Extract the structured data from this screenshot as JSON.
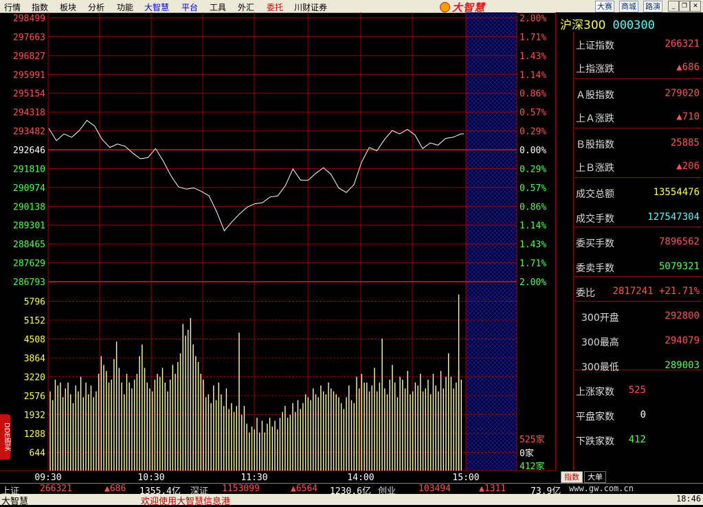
{
  "menu": {
    "items": [
      {
        "label": "行情",
        "color": "#000000"
      },
      {
        "label": "指数",
        "color": "#000000"
      },
      {
        "label": "板块",
        "color": "#000000"
      },
      {
        "label": "分析",
        "color": "#000000"
      },
      {
        "label": "功能",
        "color": "#000000"
      },
      {
        "label": "大智慧",
        "color": "#0000c8"
      },
      {
        "label": "平台",
        "color": "#0000c8"
      },
      {
        "label": "工具",
        "color": "#000000"
      },
      {
        "label": "外汇",
        "color": "#000000"
      },
      {
        "label": "委托",
        "color": "#c80000"
      },
      {
        "label": "川财证券",
        "color": "#000000"
      }
    ],
    "brand": "大智慧",
    "right_buttons": [
      "大赛",
      "商城",
      "路演"
    ]
  },
  "colors": {
    "up": "#ff5454",
    "down": "#54ff54",
    "grid": "#a00000",
    "line": "#ffffff",
    "volume": "#ffffb0",
    "yellow": "#ffff54",
    "cyan": "#54ffff"
  },
  "chart_data": {
    "type": "line",
    "price_axis_left": [
      "298499",
      "297663",
      "296827",
      "295991",
      "295154",
      "294318",
      "293482",
      "292646",
      "291810",
      "290974",
      "290138",
      "289301",
      "288465",
      "287629",
      "286793"
    ],
    "pct_axis_right": [
      "2.00%",
      "1.71%",
      "1.43%",
      "1.14%",
      "0.86%",
      "0.57%",
      "0.29%",
      "0.00%",
      "0.29%",
      "0.57%",
      "0.86%",
      "1.14%",
      "1.43%",
      "1.71%",
      "2.00%"
    ],
    "base_price": "292646",
    "ylim": [
      286793,
      298499
    ],
    "x_ticks": [
      "09:30",
      "10:30",
      "11:30",
      "14:00",
      "15:00"
    ],
    "price_series": [
      {
        "t": 0,
        "v": 293600
      },
      {
        "t": 5,
        "v": 293050
      },
      {
        "t": 10,
        "v": 293350
      },
      {
        "t": 15,
        "v": 293200
      },
      {
        "t": 20,
        "v": 293500
      },
      {
        "t": 25,
        "v": 293950
      },
      {
        "t": 30,
        "v": 293700
      },
      {
        "t": 35,
        "v": 293100
      },
      {
        "t": 40,
        "v": 292750
      },
      {
        "t": 45,
        "v": 292900
      },
      {
        "t": 50,
        "v": 292800
      },
      {
        "t": 55,
        "v": 292500
      },
      {
        "t": 60,
        "v": 292250
      },
      {
        "t": 65,
        "v": 292300
      },
      {
        "t": 70,
        "v": 292700
      },
      {
        "t": 75,
        "v": 292150
      },
      {
        "t": 80,
        "v": 291500
      },
      {
        "t": 85,
        "v": 291000
      },
      {
        "t": 90,
        "v": 290900
      },
      {
        "t": 95,
        "v": 290950
      },
      {
        "t": 100,
        "v": 290800
      },
      {
        "t": 105,
        "v": 290600
      },
      {
        "t": 110,
        "v": 289900
      },
      {
        "t": 115,
        "v": 289050
      },
      {
        "t": 120,
        "v": 289450
      },
      {
        "t": 125,
        "v": 289800
      },
      {
        "t": 130,
        "v": 290100
      },
      {
        "t": 135,
        "v": 290250
      },
      {
        "t": 140,
        "v": 290300
      },
      {
        "t": 145,
        "v": 290550
      },
      {
        "t": 150,
        "v": 290600
      },
      {
        "t": 155,
        "v": 291050
      },
      {
        "t": 160,
        "v": 291800
      },
      {
        "t": 165,
        "v": 291300
      },
      {
        "t": 170,
        "v": 291300
      },
      {
        "t": 175,
        "v": 291600
      },
      {
        "t": 180,
        "v": 291850
      },
      {
        "t": 185,
        "v": 291550
      },
      {
        "t": 190,
        "v": 290950
      },
      {
        "t": 195,
        "v": 290750
      },
      {
        "t": 200,
        "v": 291100
      },
      {
        "t": 205,
        "v": 292100
      },
      {
        "t": 210,
        "v": 292750
      },
      {
        "t": 215,
        "v": 292600
      },
      {
        "t": 220,
        "v": 293100
      },
      {
        "t": 225,
        "v": 293500
      },
      {
        "t": 230,
        "v": 293350
      },
      {
        "t": 235,
        "v": 293550
      },
      {
        "t": 240,
        "v": 293300
      },
      {
        "t": 245,
        "v": 292700
      },
      {
        "t": 250,
        "v": 292950
      },
      {
        "t": 255,
        "v": 292850
      },
      {
        "t": 260,
        "v": 293150
      },
      {
        "t": 265,
        "v": 293200
      },
      {
        "t": 270,
        "v": 293350
      },
      {
        "t": 272,
        "v": 293350
      }
    ],
    "volume_axis_left": [
      "5796",
      "5152",
      "4508",
      "3864",
      "3220",
      "2576",
      "1932",
      "1288",
      "644"
    ],
    "volume_ylim": [
      0,
      6440
    ],
    "volume_series": [
      2700,
      2400,
      3100,
      2900,
      3000,
      2500,
      2800,
      3000,
      2600,
      2300,
      2900,
      2700,
      3200,
      2500,
      3000,
      2600,
      2900,
      2500,
      2700,
      3300,
      3900,
      3600,
      3400,
      3000,
      3100,
      3800,
      4400,
      3500,
      3000,
      2600,
      3300,
      3000,
      2800,
      3100,
      3300,
      3900,
      4300,
      3500,
      3000,
      2800,
      2700,
      3100,
      3300,
      3200,
      3500,
      3000,
      2700,
      3100,
      3600,
      3300,
      3700,
      4000,
      5000,
      4600,
      4800,
      5200,
      4300,
      3900,
      3700,
      3300,
      3100,
      2500,
      2600,
      2300,
      2900,
      2400,
      3000,
      2600,
      2200,
      2800,
      2100,
      2300,
      2000,
      2200,
      4700,
      1900,
      2200,
      1600,
      1300,
      1500,
      1400,
      1800,
      1300,
      1700,
      1300,
      1600,
      1800,
      1500,
      1700,
      1400,
      1800,
      2000,
      2200,
      1800,
      1900,
      2300,
      2000,
      2400,
      2100,
      2300,
      2600,
      2500,
      2400,
      2800,
      2600,
      2500,
      2900,
      2700,
      2600,
      3000,
      2800,
      2700,
      2600,
      2500,
      2300,
      2100,
      2500,
      2900,
      2400,
      2300,
      3200,
      2800,
      3300,
      3000,
      3000,
      2700,
      2900,
      3500,
      2700,
      3000,
      4500,
      2800,
      2600,
      3100,
      3600,
      3000,
      2500,
      3200,
      3100,
      2800,
      3400,
      2600,
      2700,
      3000,
      2900,
      3300,
      2700,
      2800,
      3100,
      2600,
      3300,
      2900,
      2700,
      3400,
      2800,
      3200,
      4000,
      3200,
      2800,
      3000,
      3400,
      3100
    ],
    "volume_spikes": [
      {
        "index": 160,
        "v": 6000
      }
    ],
    "breadth_labels": [
      "525家",
      "0家",
      "412家"
    ]
  },
  "panel": {
    "title": "沪深300",
    "code": "000300",
    "rows": [
      {
        "k": "上证指数",
        "v": "266321",
        "color": "#ff5454",
        "arrow": false
      },
      {
        "k": "上指涨跌",
        "v": "▲686",
        "color": "#ff5454",
        "arrow": true
      },
      {
        "k": "Ａ股指数",
        "v": "279020",
        "color": "#ff5454",
        "arrow": false
      },
      {
        "k": "上Ａ涨跌",
        "v": "▲710",
        "color": "#ff5454",
        "arrow": true
      },
      {
        "k": "Ｂ股指数",
        "v": "25885",
        "color": "#ff5454",
        "arrow": false
      },
      {
        "k": "上Ｂ涨跌",
        "v": "▲206",
        "color": "#ff5454",
        "arrow": true
      },
      {
        "k": "成交总额",
        "v": "13554476",
        "color": "#ffff54",
        "arrow": false
      },
      {
        "k": "成交手数",
        "v": "127547304",
        "color": "#54ffff",
        "arrow": false
      },
      {
        "k": "委买手数",
        "v": "7896562",
        "color": "#ff5454",
        "arrow": false
      },
      {
        "k": "委卖手数",
        "v": "5079321",
        "color": "#54ff54",
        "arrow": false
      },
      {
        "k": "委比",
        "v": "2817241 +21.71%",
        "color": "#ff5454",
        "arrow": false
      },
      {
        "k": "300开盘",
        "v": "292800",
        "color": "#ff5454",
        "arrow": false
      },
      {
        "k": "300最高",
        "v": "294079",
        "color": "#ff5454",
        "arrow": false
      },
      {
        "k": "300最低",
        "v": "289003",
        "color": "#54ff54",
        "arrow": false
      },
      {
        "k": "上涨家数",
        "v": "525",
        "color": "#ff5454",
        "arrow": false
      },
      {
        "k": "平盘家数",
        "v": "0",
        "color": "#ffffff",
        "arrow": false
      },
      {
        "k": "下跌家数",
        "v": "412",
        "color": "#54ff54",
        "arrow": false
      }
    ]
  },
  "tabs": [
    "指数",
    "大单"
  ],
  "status": {
    "sh_label": "上证",
    "sh_value": "266321",
    "sh_change": "▲686",
    "sh_amount": "1355.4亿",
    "sz_label": "深证",
    "sz_value": "1153099",
    "sz_change": "▲6564",
    "sz_amount": "1230.6亿",
    "cy_label": "创业",
    "cy_value": "103494",
    "cy_change": "▲1311",
    "cy_amount": "73.9亿",
    "url": "www.gw.com.cn"
  },
  "status2": {
    "app": "大智慧",
    "ticker": "欢迎使用大智慧信息港",
    "clock": "18:46"
  },
  "side_badge": "DDE购买"
}
